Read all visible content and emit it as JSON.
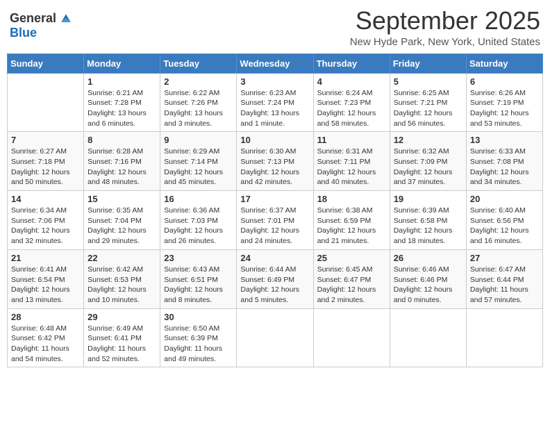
{
  "header": {
    "logo": {
      "general": "General",
      "blue": "Blue"
    },
    "title": "September 2025",
    "location": "New Hyde Park, New York, United States"
  },
  "weekdays": [
    "Sunday",
    "Monday",
    "Tuesday",
    "Wednesday",
    "Thursday",
    "Friday",
    "Saturday"
  ],
  "weeks": [
    [
      {
        "day": "",
        "info": ""
      },
      {
        "day": "1",
        "info": "Sunrise: 6:21 AM\nSunset: 7:28 PM\nDaylight: 13 hours\nand 6 minutes."
      },
      {
        "day": "2",
        "info": "Sunrise: 6:22 AM\nSunset: 7:26 PM\nDaylight: 13 hours\nand 3 minutes."
      },
      {
        "day": "3",
        "info": "Sunrise: 6:23 AM\nSunset: 7:24 PM\nDaylight: 13 hours\nand 1 minute."
      },
      {
        "day": "4",
        "info": "Sunrise: 6:24 AM\nSunset: 7:23 PM\nDaylight: 12 hours\nand 58 minutes."
      },
      {
        "day": "5",
        "info": "Sunrise: 6:25 AM\nSunset: 7:21 PM\nDaylight: 12 hours\nand 56 minutes."
      },
      {
        "day": "6",
        "info": "Sunrise: 6:26 AM\nSunset: 7:19 PM\nDaylight: 12 hours\nand 53 minutes."
      }
    ],
    [
      {
        "day": "7",
        "info": "Sunrise: 6:27 AM\nSunset: 7:18 PM\nDaylight: 12 hours\nand 50 minutes."
      },
      {
        "day": "8",
        "info": "Sunrise: 6:28 AM\nSunset: 7:16 PM\nDaylight: 12 hours\nand 48 minutes."
      },
      {
        "day": "9",
        "info": "Sunrise: 6:29 AM\nSunset: 7:14 PM\nDaylight: 12 hours\nand 45 minutes."
      },
      {
        "day": "10",
        "info": "Sunrise: 6:30 AM\nSunset: 7:13 PM\nDaylight: 12 hours\nand 42 minutes."
      },
      {
        "day": "11",
        "info": "Sunrise: 6:31 AM\nSunset: 7:11 PM\nDaylight: 12 hours\nand 40 minutes."
      },
      {
        "day": "12",
        "info": "Sunrise: 6:32 AM\nSunset: 7:09 PM\nDaylight: 12 hours\nand 37 minutes."
      },
      {
        "day": "13",
        "info": "Sunrise: 6:33 AM\nSunset: 7:08 PM\nDaylight: 12 hours\nand 34 minutes."
      }
    ],
    [
      {
        "day": "14",
        "info": "Sunrise: 6:34 AM\nSunset: 7:06 PM\nDaylight: 12 hours\nand 32 minutes."
      },
      {
        "day": "15",
        "info": "Sunrise: 6:35 AM\nSunset: 7:04 PM\nDaylight: 12 hours\nand 29 minutes."
      },
      {
        "day": "16",
        "info": "Sunrise: 6:36 AM\nSunset: 7:03 PM\nDaylight: 12 hours\nand 26 minutes."
      },
      {
        "day": "17",
        "info": "Sunrise: 6:37 AM\nSunset: 7:01 PM\nDaylight: 12 hours\nand 24 minutes."
      },
      {
        "day": "18",
        "info": "Sunrise: 6:38 AM\nSunset: 6:59 PM\nDaylight: 12 hours\nand 21 minutes."
      },
      {
        "day": "19",
        "info": "Sunrise: 6:39 AM\nSunset: 6:58 PM\nDaylight: 12 hours\nand 18 minutes."
      },
      {
        "day": "20",
        "info": "Sunrise: 6:40 AM\nSunset: 6:56 PM\nDaylight: 12 hours\nand 16 minutes."
      }
    ],
    [
      {
        "day": "21",
        "info": "Sunrise: 6:41 AM\nSunset: 6:54 PM\nDaylight: 12 hours\nand 13 minutes."
      },
      {
        "day": "22",
        "info": "Sunrise: 6:42 AM\nSunset: 6:53 PM\nDaylight: 12 hours\nand 10 minutes."
      },
      {
        "day": "23",
        "info": "Sunrise: 6:43 AM\nSunset: 6:51 PM\nDaylight: 12 hours\nand 8 minutes."
      },
      {
        "day": "24",
        "info": "Sunrise: 6:44 AM\nSunset: 6:49 PM\nDaylight: 12 hours\nand 5 minutes."
      },
      {
        "day": "25",
        "info": "Sunrise: 6:45 AM\nSunset: 6:47 PM\nDaylight: 12 hours\nand 2 minutes."
      },
      {
        "day": "26",
        "info": "Sunrise: 6:46 AM\nSunset: 6:46 PM\nDaylight: 12 hours\nand 0 minutes."
      },
      {
        "day": "27",
        "info": "Sunrise: 6:47 AM\nSunset: 6:44 PM\nDaylight: 11 hours\nand 57 minutes."
      }
    ],
    [
      {
        "day": "28",
        "info": "Sunrise: 6:48 AM\nSunset: 6:42 PM\nDaylight: 11 hours\nand 54 minutes."
      },
      {
        "day": "29",
        "info": "Sunrise: 6:49 AM\nSunset: 6:41 PM\nDaylight: 11 hours\nand 52 minutes."
      },
      {
        "day": "30",
        "info": "Sunrise: 6:50 AM\nSunset: 6:39 PM\nDaylight: 11 hours\nand 49 minutes."
      },
      {
        "day": "",
        "info": ""
      },
      {
        "day": "",
        "info": ""
      },
      {
        "day": "",
        "info": ""
      },
      {
        "day": "",
        "info": ""
      }
    ]
  ]
}
